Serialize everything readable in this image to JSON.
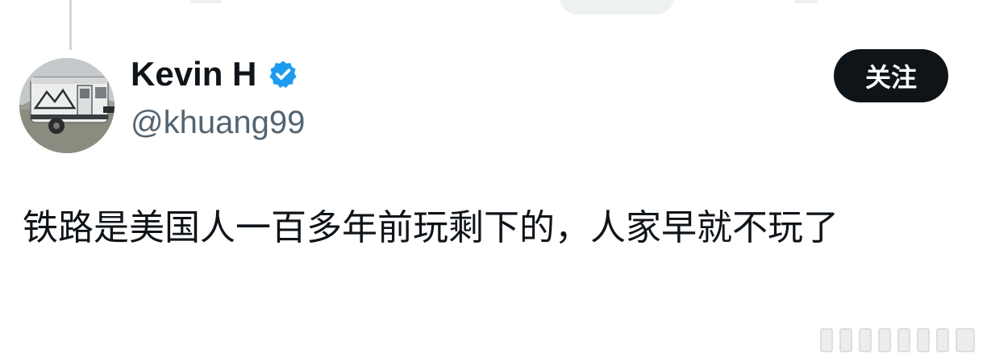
{
  "author": {
    "display_name": "Kevin H",
    "handle": "@khuang99",
    "verified": true
  },
  "follow_button": {
    "label": "关注"
  },
  "tweet": {
    "text": "铁路是美国人一百多年前玩剩下的，人家早就不玩了"
  },
  "colors": {
    "primary_text": "#0f1419",
    "secondary_text": "#536471",
    "verified_badge": "#1d9bf0",
    "follow_button_bg": "#0f1419",
    "follow_button_text": "#ffffff"
  },
  "icons": {
    "verified": "verified-badge-icon",
    "avatar": "camper-trailer-avatar"
  }
}
